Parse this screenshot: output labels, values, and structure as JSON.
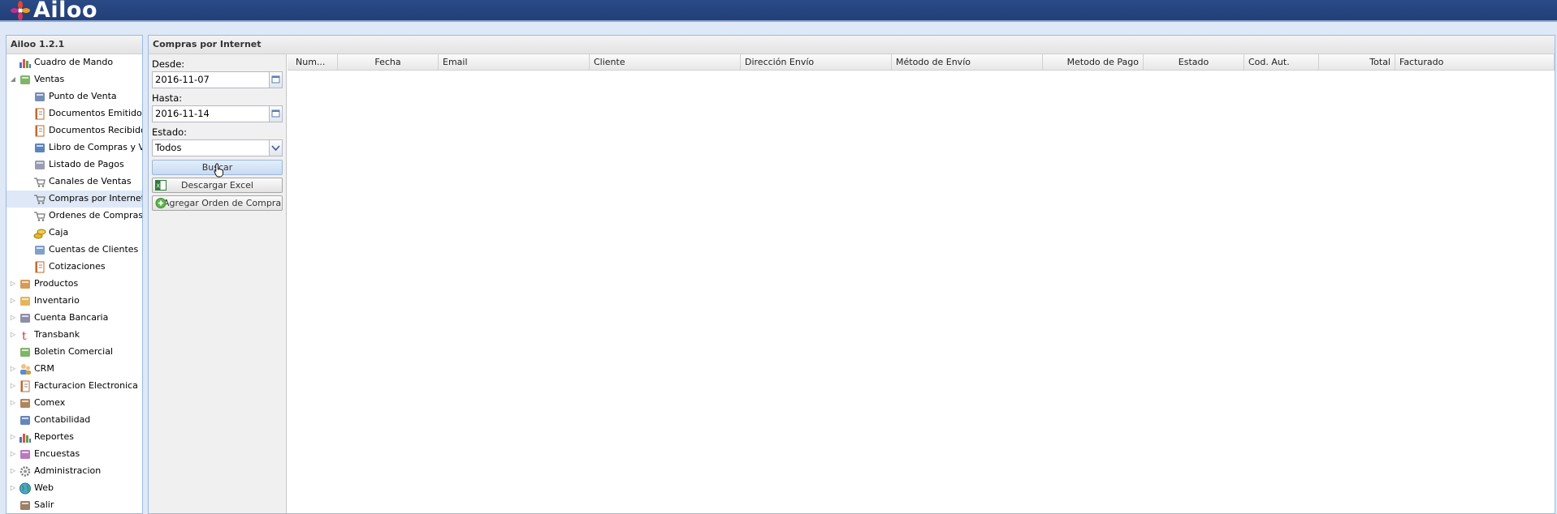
{
  "app": {
    "logo_text": "Ailoo",
    "version": "Ailoo 1.2.1"
  },
  "sidebar": {
    "items": [
      {
        "label": "Cuadro de Mando",
        "icon": "chart-icon"
      },
      {
        "label": "Ventas",
        "icon": "tag-icon",
        "expanded": true
      },
      {
        "label": "Punto de Venta",
        "icon": "pos-icon"
      },
      {
        "label": "Documentos Emitidos",
        "icon": "document-icon"
      },
      {
        "label": "Documentos Recibidos",
        "icon": "document-icon"
      },
      {
        "label": "Libro de Compras y Ventas",
        "icon": "book-icon"
      },
      {
        "label": "Listado de Pagos",
        "icon": "payments-icon"
      },
      {
        "label": "Canales de Ventas",
        "icon": "cart-icon"
      },
      {
        "label": "Compras por Internet",
        "icon": "cart-icon",
        "selected": true
      },
      {
        "label": "Ordenes de Compras",
        "icon": "cart-icon"
      },
      {
        "label": "Caja",
        "icon": "coins-icon"
      },
      {
        "label": "Cuentas de Clientes",
        "icon": "card-icon"
      },
      {
        "label": "Cotizaciones",
        "icon": "document-icon"
      },
      {
        "label": "Productos",
        "icon": "box-icon"
      },
      {
        "label": "Inventario",
        "icon": "package-icon"
      },
      {
        "label": "Cuenta Bancaria",
        "icon": "bank-icon"
      },
      {
        "label": "Transbank",
        "icon": "transbank-icon"
      },
      {
        "label": "Boletin Comercial",
        "icon": "tag-icon"
      },
      {
        "label": "CRM",
        "icon": "users-icon"
      },
      {
        "label": "Facturacion Electronica",
        "icon": "document-icon"
      },
      {
        "label": "Comex",
        "icon": "truck-icon"
      },
      {
        "label": "Contabilidad",
        "icon": "calculator-icon"
      },
      {
        "label": "Reportes",
        "icon": "chart-icon"
      },
      {
        "label": "Encuestas",
        "icon": "survey-icon"
      },
      {
        "label": "Administracion",
        "icon": "gear-icon"
      },
      {
        "label": "Web",
        "icon": "globe-icon"
      },
      {
        "label": "Salir",
        "icon": "exit-icon"
      }
    ]
  },
  "main": {
    "title": "Compras por Internet",
    "filters": {
      "desde_label": "Desde:",
      "desde_value": "2016-11-07",
      "hasta_label": "Hasta:",
      "hasta_value": "2016-11-14",
      "estado_label": "Estado:",
      "estado_value": "Todos",
      "buscar_label": "Buscar",
      "excel_label": "Descargar Excel",
      "agregar_label": "Agregar Orden de Compra"
    },
    "grid": {
      "columns": [
        "Num...",
        "Fecha",
        "Email",
        "Cliente",
        "Dirección Envío",
        "Método de Envío",
        "Metodo de Pago",
        "Estado",
        "Cod. Aut.",
        "Total",
        "Facturado"
      ],
      "rows": []
    }
  },
  "colors": {
    "topbar": "#223f78",
    "panel_border": "#99bbe8",
    "selected_row": "#dfe8f6"
  }
}
